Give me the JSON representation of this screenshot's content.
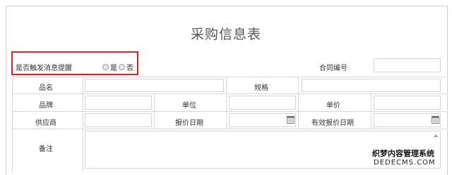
{
  "form": {
    "title": "采购信息表",
    "remind_label": "是否触发消息提醒",
    "remind_yes": "是",
    "remind_no": "否",
    "contract_no_label": "合同编号",
    "product_name_label": "品名",
    "spec_label": "规格",
    "brand_label": "品牌",
    "unit_label": "单位",
    "unit_price_label": "单价",
    "supplier_label": "供应商",
    "quote_date_label": "报价日期",
    "valid_quote_date_label": "有效报价日期",
    "remarks_label": "备注"
  },
  "watermark": {
    "line1": "织梦内容管理系统",
    "line2": "DEDECMS.COM"
  }
}
